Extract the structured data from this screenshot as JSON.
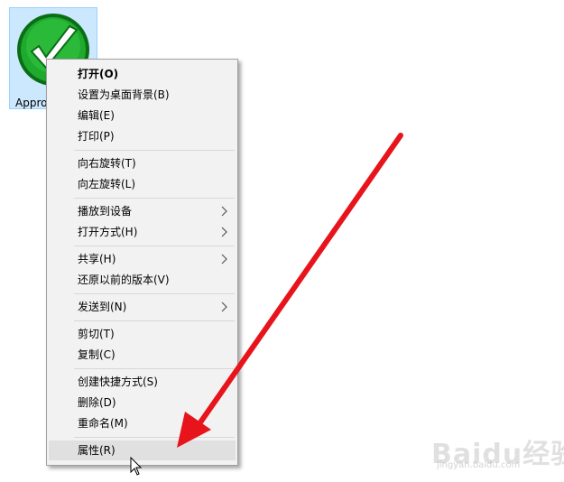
{
  "desktop": {
    "file_icon": {
      "label": "Appro",
      "icon": "green-checkmark-icon"
    }
  },
  "context_menu": {
    "groups": [
      [
        {
          "label": "打开(O)",
          "bold": true
        },
        {
          "label": "设置为桌面背景(B)"
        },
        {
          "label": "编辑(E)"
        },
        {
          "label": "打印(P)"
        }
      ],
      [
        {
          "label": "向右旋转(T)"
        },
        {
          "label": "向左旋转(L)"
        }
      ],
      [
        {
          "label": "播放到设备",
          "submenu": true
        },
        {
          "label": "打开方式(H)",
          "submenu": true
        }
      ],
      [
        {
          "label": "共享(H)",
          "submenu": true
        },
        {
          "label": "还原以前的版本(V)"
        }
      ],
      [
        {
          "label": "发送到(N)",
          "submenu": true
        }
      ],
      [
        {
          "label": "剪切(T)"
        },
        {
          "label": "复制(C)"
        }
      ],
      [
        {
          "label": "创建快捷方式(S)"
        },
        {
          "label": "删除(D)"
        },
        {
          "label": "重命名(M)"
        }
      ],
      [
        {
          "label": "属性(R)",
          "highlighted": true
        }
      ]
    ]
  },
  "watermark": {
    "text": "Baidu经验",
    "subtext": "jingyan.baidu.com"
  },
  "colors": {
    "arrow": "#e8141c",
    "icon_green": "#1faa2e",
    "selection": "#cce8ff"
  }
}
